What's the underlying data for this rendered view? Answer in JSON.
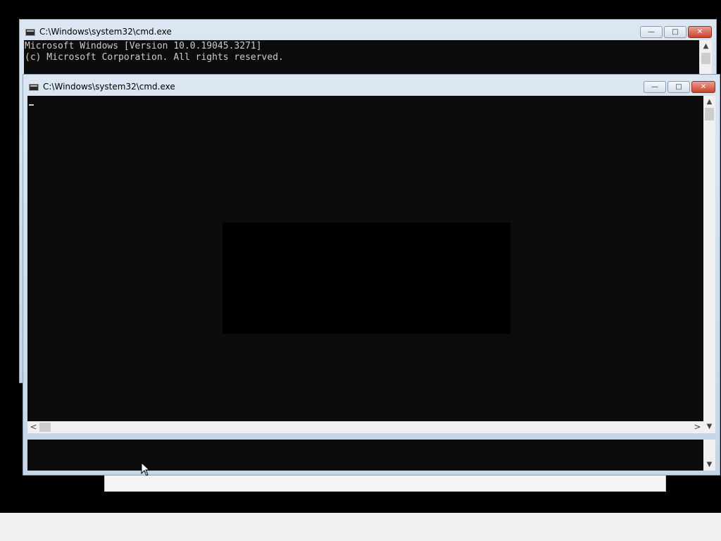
{
  "background_window": {
    "title": "C:\\Windows\\system32\\cmd.exe",
    "console_lines": [
      "Microsoft Windows [Version 10.0.19045.3271]",
      "(c) Microsoft Corporation. All rights reserved."
    ]
  },
  "foreground_window": {
    "title": "C:\\Windows\\system32\\cmd.exe"
  },
  "controls": {
    "minimize": "—",
    "maximize": "□",
    "close": "✕"
  },
  "scroll_arrows": {
    "up": "▲",
    "down": "▼",
    "left": "<",
    "right": ">"
  },
  "icons": {
    "window_icon": "cmd-console-icon",
    "pointer": "mouse-pointer-icon"
  },
  "colors": {
    "console_bg": "#0c0c0c",
    "console_fg": "#cccccc",
    "close_button": "#c8422d",
    "frame": "#c6d5e6"
  }
}
